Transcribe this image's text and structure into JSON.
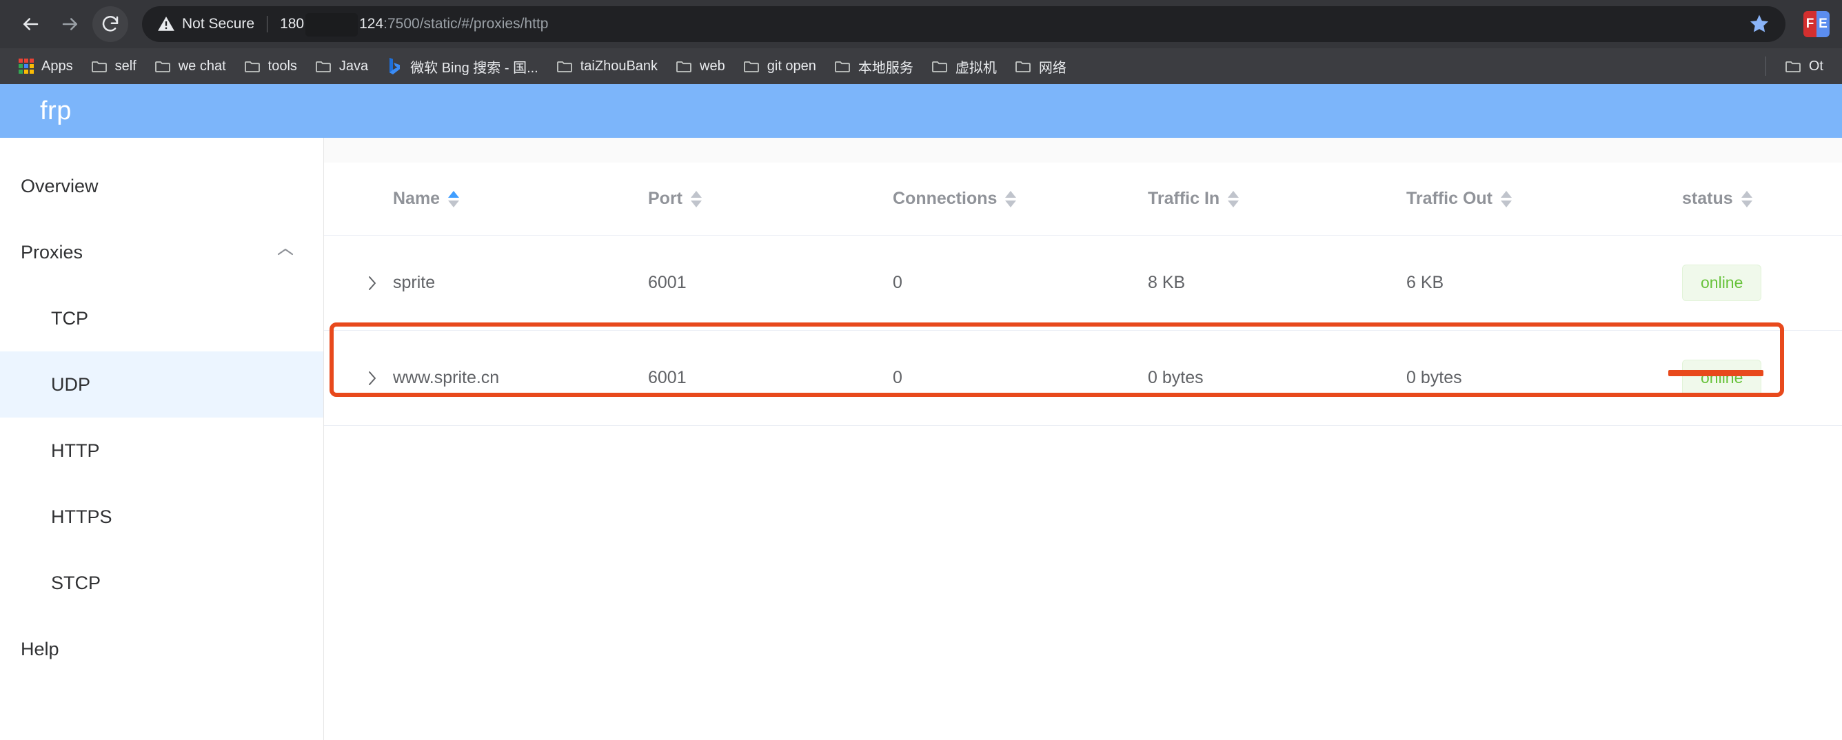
{
  "browser": {
    "back_label": "Back",
    "forward_label": "Forward",
    "reload_label": "Reload",
    "security_label": "Not Secure",
    "url_prefix": "180",
    "url_suffix_host": "124",
    "url_path": ":7500/static/#/proxies/http",
    "bookmark_star_label": "Bookmark this tab",
    "extension_icon_left": "F",
    "extension_icon_right": "E",
    "bookmarks": [
      {
        "label": "Apps",
        "icon": "apps-grid-icon"
      },
      {
        "label": "self",
        "icon": "folder-icon"
      },
      {
        "label": "we chat",
        "icon": "folder-icon"
      },
      {
        "label": "tools",
        "icon": "folder-icon"
      },
      {
        "label": "Java",
        "icon": "folder-icon"
      },
      {
        "label": "微软 Bing 搜索 - 国...",
        "icon": "bing-icon"
      },
      {
        "label": "taiZhouBank",
        "icon": "folder-icon"
      },
      {
        "label": "web",
        "icon": "folder-icon"
      },
      {
        "label": "git open",
        "icon": "folder-icon"
      },
      {
        "label": "本地服务",
        "icon": "folder-icon"
      },
      {
        "label": "虚拟机",
        "icon": "folder-icon"
      },
      {
        "label": "网络",
        "icon": "folder-icon"
      }
    ],
    "other_bookmarks": {
      "label": "Ot",
      "icon": "folder-icon"
    }
  },
  "app": {
    "title": "frp",
    "header_color": "#7CB5FA"
  },
  "sidebar": {
    "items": [
      {
        "label": "Overview",
        "active": false,
        "sub": false
      },
      {
        "label": "Proxies",
        "active": false,
        "sub": false,
        "chevron": "chevron-up-icon"
      },
      {
        "label": "TCP",
        "active": false,
        "sub": true
      },
      {
        "label": "UDP",
        "active": true,
        "sub": true
      },
      {
        "label": "HTTP",
        "active": false,
        "sub": true
      },
      {
        "label": "HTTPS",
        "active": false,
        "sub": true
      },
      {
        "label": "STCP",
        "active": false,
        "sub": true
      },
      {
        "label": "Help",
        "active": false,
        "sub": false
      }
    ],
    "active_bg": "#ECF5FF"
  },
  "table": {
    "columns": [
      {
        "label": "Name",
        "sort": "asc"
      },
      {
        "label": "Port",
        "sort": "none"
      },
      {
        "label": "Connections",
        "sort": "none"
      },
      {
        "label": "Traffic In",
        "sort": "none"
      },
      {
        "label": "Traffic Out",
        "sort": "none"
      },
      {
        "label": "status",
        "sort": "none"
      }
    ],
    "rows": [
      {
        "expand": "chevron-right-icon",
        "name": "sprite",
        "port": "6001",
        "connections": "0",
        "traffic_in": "8 KB",
        "traffic_out": "6 KB",
        "status": "online"
      },
      {
        "expand": "chevron-right-icon",
        "name": "www.sprite.cn",
        "port": "6001",
        "connections": "0",
        "traffic_in": "0 bytes",
        "traffic_out": "0 bytes",
        "status": "online"
      }
    ],
    "status_badge_bg": "#F0F9EB",
    "status_badge_color": "#67C23A"
  },
  "annotations": {
    "color": "#E8491C",
    "row_highlight_label": "highlighted-row-www-sprite-cn",
    "underline_label": "highlighted-status-online"
  }
}
